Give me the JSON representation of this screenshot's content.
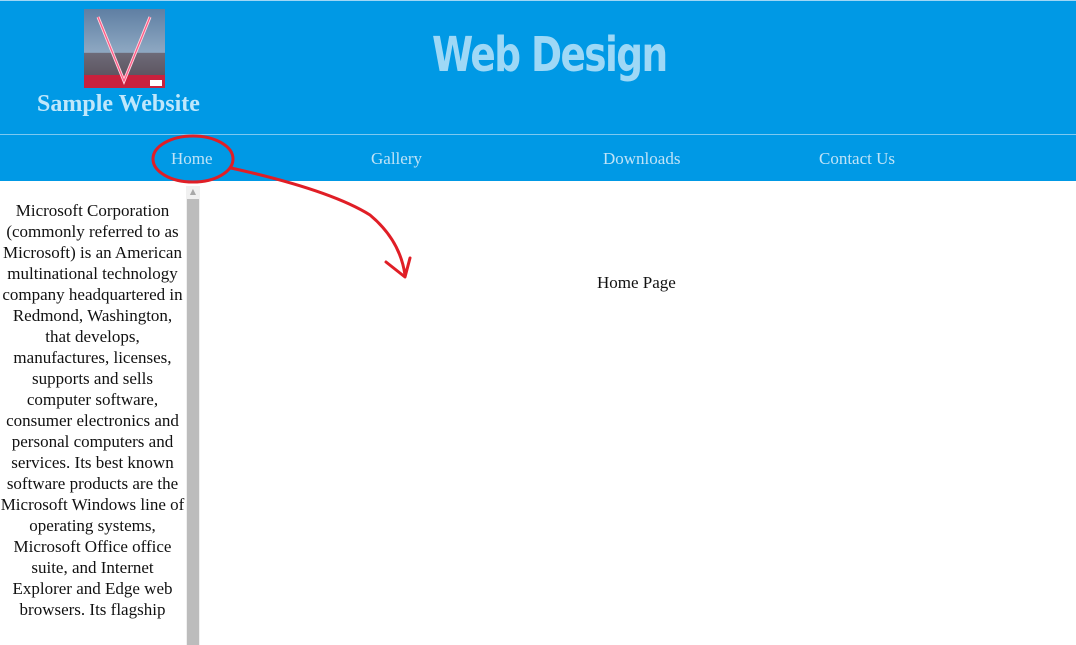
{
  "header": {
    "site_name": "Sample Website",
    "title": "Web Design",
    "logo_icon": "album-cover-v-icon",
    "background_color": "#0099e5"
  },
  "nav": {
    "items": [
      {
        "label": "Home"
      },
      {
        "label": "Gallery"
      },
      {
        "label": "Downloads"
      },
      {
        "label": "Contact Us"
      }
    ]
  },
  "sidebar": {
    "text": "Microsoft Corporation (commonly referred to as Microsoft) is an American multinational technology company headquartered in Redmond, Washington, that develops, manufactures, licenses, supports and sells computer software, consumer electronics and personal computers and services. Its best known software products are the Microsoft Windows line of operating systems, Microsoft Office office suite, and Internet Explorer and Edge web browsers. Its flagship"
  },
  "content": {
    "text": "Home Page"
  },
  "annotation": {
    "color": "#e01e26"
  }
}
